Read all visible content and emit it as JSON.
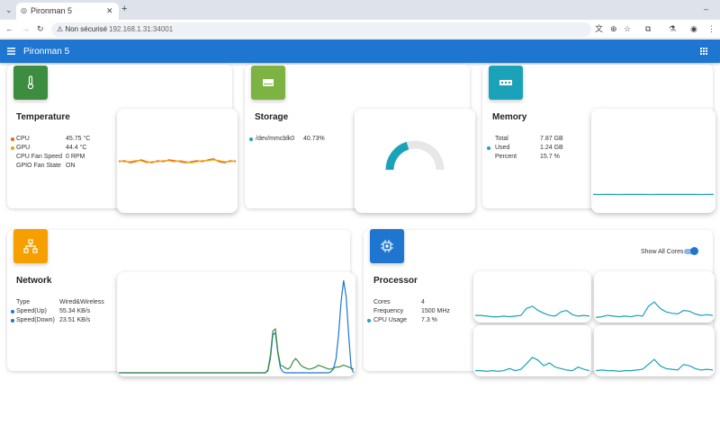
{
  "browser": {
    "tab_title": "Pironman 5",
    "new_tab": "+",
    "url_warning": "Non sécurisé",
    "url": "192.168.1.31:34001"
  },
  "app": {
    "title": "Pironman 5"
  },
  "temperature": {
    "title": "Temperature",
    "rows": [
      {
        "label": "CPU",
        "value": "45.75 °C",
        "color": "#e8641b"
      },
      {
        "label": "GPU",
        "value": "44.4 °C",
        "color": "#f0a400"
      },
      {
        "label": "CPU Fan Speed",
        "value": "0 RPM"
      },
      {
        "label": "GPIO Fan State",
        "value": "ON"
      }
    ],
    "icon_color": "#3c8d3f",
    "icon": "thermometer-icon"
  },
  "storage": {
    "title": "Storage",
    "rows": [
      {
        "label": "/dev/mmcblk0",
        "value": "40.73%",
        "color": "#1aa3b8"
      }
    ],
    "icon_color": "#7cb342",
    "icon": "hard-drive-icon",
    "gauge_percent": 40.73
  },
  "memory": {
    "title": "Memory",
    "rows": [
      {
        "label": "Total",
        "value": "7.87 GB"
      },
      {
        "label": "Used",
        "value": "1.24 GB",
        "color": "#1aa3b8"
      },
      {
        "label": "Percent",
        "value": "15.7 %"
      }
    ],
    "icon_color": "#1aa3b8",
    "icon": "memory-icon"
  },
  "network": {
    "title": "Network",
    "rows": [
      {
        "label": "Type",
        "value": "Wired&Wireless"
      },
      {
        "label": "Speed(Up)",
        "value": "55.34 KB/s",
        "color": "#1e76d0"
      },
      {
        "label": "Speed(Down)",
        "value": "23.51 KB/s",
        "color": "#1e76d0"
      }
    ],
    "icon_color": "#f5a000",
    "icon": "network-icon"
  },
  "processor": {
    "title": "Processor",
    "rows": [
      {
        "label": "Cores",
        "value": "4"
      },
      {
        "label": "Frequency",
        "value": "1500 MHz"
      },
      {
        "label": "CPU Usage",
        "value": "7.3 %",
        "color": "#1aa3b8"
      }
    ],
    "icon_color": "#1e76d0",
    "icon": "cpu-icon",
    "show_all_cores_label": "Show All Cores",
    "show_all_cores": true
  },
  "chart_data": [
    {
      "type": "line",
      "title": "",
      "series": [
        {
          "color": "#e8641b",
          "values": [
            50,
            51,
            49,
            50,
            52,
            50,
            49,
            51,
            50,
            52,
            51,
            50,
            49,
            50,
            51,
            50,
            52,
            53,
            50,
            49,
            51,
            50
          ]
        },
        {
          "color": "#f0a400",
          "values": [
            51,
            50,
            50,
            51,
            51,
            49,
            50,
            50,
            51,
            51,
            50,
            51,
            50,
            49,
            50,
            51,
            51,
            52,
            51,
            50,
            50,
            51
          ]
        }
      ],
      "ylim": [
        0,
        100
      ]
    },
    {
      "type": "pie",
      "title": "",
      "values": [
        40.73,
        59.27
      ]
    },
    {
      "type": "line",
      "title": "",
      "series": [
        {
          "color": "#1aa3b8",
          "values": [
            15.7,
            15.6,
            15.7,
            15.7,
            15.6,
            15.7,
            15.8,
            15.7,
            15.7,
            15.6,
            15.7,
            15.7,
            15.7,
            15.8,
            15.7,
            15.7,
            15.7,
            15.6,
            15.7,
            15.7
          ]
        }
      ],
      "ylim": [
        0,
        100
      ]
    },
    {
      "type": "line",
      "title": "",
      "series": [
        {
          "color": "#1e76d0",
          "values": [
            0,
            0,
            0,
            0,
            0,
            0,
            0,
            0,
            0,
            0,
            0,
            0,
            0,
            0,
            0,
            0,
            0,
            0,
            0,
            0,
            0,
            0,
            0,
            0,
            0,
            0,
            0,
            0,
            0,
            0,
            0,
            0,
            0,
            0,
            0,
            0,
            0,
            0,
            0,
            0,
            0,
            0,
            0,
            0,
            0,
            0,
            0,
            0,
            0,
            0,
            0,
            0,
            0,
            0,
            0,
            0,
            0,
            0,
            0,
            2,
            15,
            40,
            42,
            20,
            5,
            1,
            0,
            0,
            0,
            0,
            0,
            0,
            0,
            0,
            0,
            0,
            0,
            0,
            0,
            0,
            0,
            0,
            0,
            0,
            1,
            4,
            15,
            40,
            75,
            97,
            80,
            40,
            5,
            0
          ]
        },
        {
          "color": "#3c8d3f",
          "values": [
            0,
            0,
            0,
            0,
            0,
            0,
            0,
            0,
            0,
            0,
            0,
            0,
            0,
            0,
            0,
            0,
            0,
            0,
            0,
            0,
            0,
            0,
            0,
            0,
            0,
            0,
            0,
            0,
            0,
            0,
            0,
            0,
            0,
            0,
            0,
            0,
            0,
            0,
            0,
            0,
            0,
            0,
            0,
            0,
            0,
            0,
            0,
            0,
            0,
            0,
            0,
            0,
            0,
            0,
            0,
            0,
            0,
            0,
            0,
            3,
            18,
            44,
            46,
            22,
            8,
            7,
            5,
            4,
            6,
            12,
            15,
            12,
            8,
            6,
            5,
            4,
            4,
            5,
            6,
            8,
            7,
            6,
            5,
            4,
            4,
            5,
            6,
            6,
            7,
            8,
            7,
            6,
            5,
            4
          ]
        }
      ],
      "ylim": [
        0,
        100
      ]
    },
    {
      "type": "line",
      "title": "",
      "series": [
        {
          "color": "#1aa3b8",
          "values": [
            5,
            5,
            4,
            3,
            3,
            4,
            3,
            4,
            5,
            15,
            18,
            12,
            8,
            5,
            4,
            10,
            12,
            6,
            4,
            5,
            4
          ]
        }
      ],
      "ylim": [
        0,
        60
      ]
    },
    {
      "type": "line",
      "title": "",
      "series": [
        {
          "color": "#1aa3b8",
          "values": [
            2,
            3,
            5,
            4,
            3,
            4,
            3,
            5,
            4,
            18,
            24,
            15,
            10,
            8,
            7,
            12,
            11,
            7,
            5,
            6,
            5
          ]
        }
      ],
      "ylim": [
        0,
        60
      ]
    },
    {
      "type": "line",
      "title": "",
      "series": [
        {
          "color": "#1aa3b8",
          "values": [
            3,
            3,
            2,
            3,
            2,
            3,
            6,
            3,
            5,
            13,
            22,
            18,
            10,
            14,
            8,
            6,
            4,
            3,
            8,
            5,
            3
          ]
        }
      ],
      "ylim": [
        0,
        60
      ]
    },
    {
      "type": "line",
      "title": "",
      "series": [
        {
          "color": "#1aa3b8",
          "values": [
            3,
            4,
            3,
            3,
            2,
            3,
            3,
            4,
            5,
            12,
            19,
            10,
            6,
            5,
            4,
            12,
            10,
            6,
            4,
            5,
            4
          ]
        }
      ],
      "ylim": [
        0,
        60
      ]
    }
  ]
}
